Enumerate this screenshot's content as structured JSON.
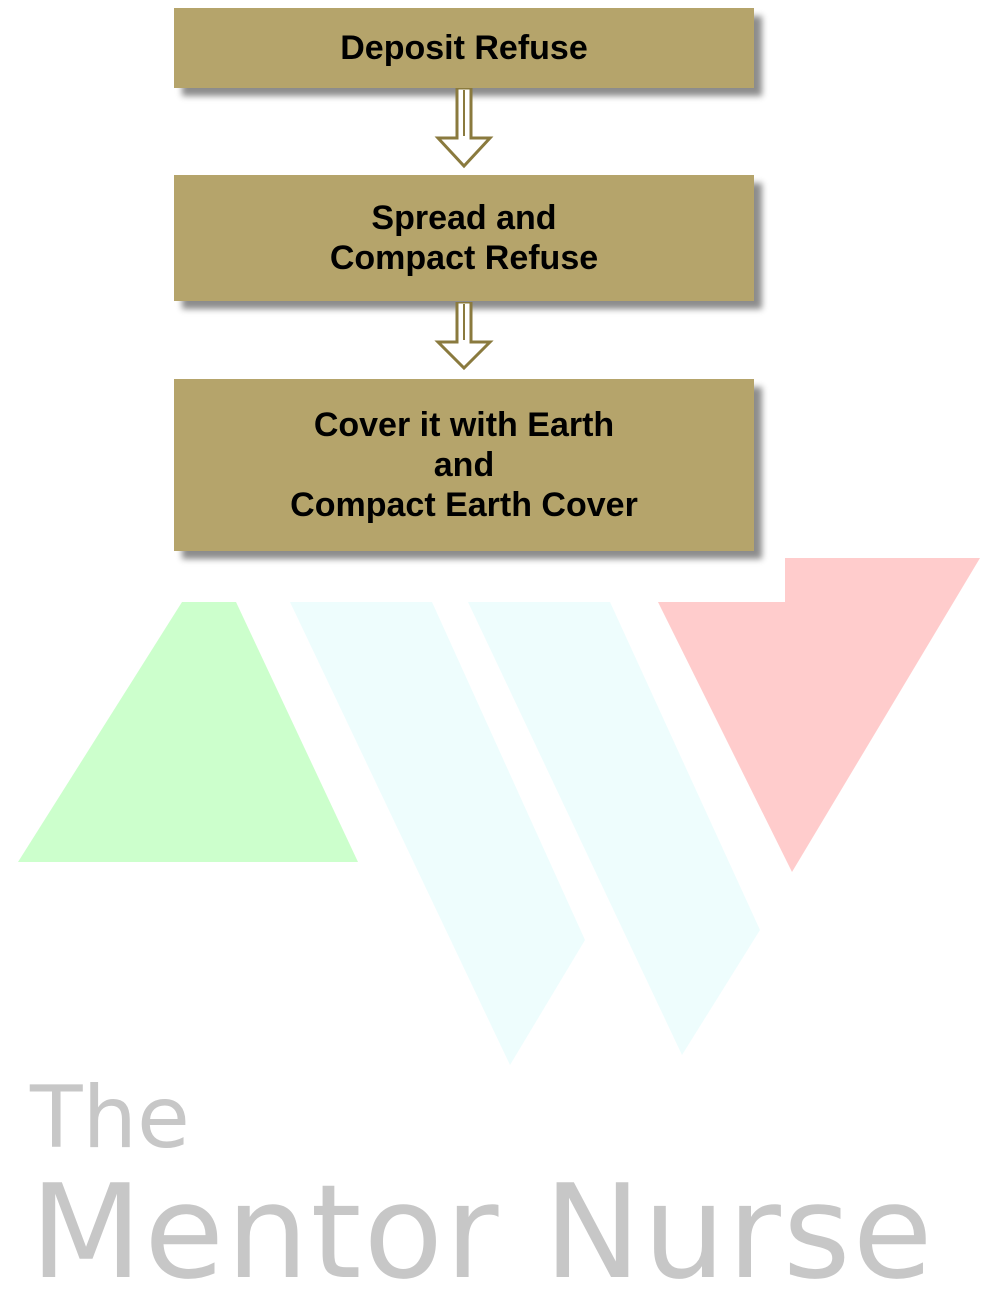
{
  "diagram": {
    "steps": [
      {
        "lines": [
          "Deposit Refuse"
        ]
      },
      {
        "lines": [
          "Spread and",
          "Compact Refuse"
        ]
      },
      {
        "lines": [
          "Cover it with Earth",
          "and",
          "Compact Earth Cover"
        ]
      }
    ],
    "box_color": "#b5a46b",
    "arrow_color": "#8a7a3e"
  },
  "watermark": {
    "brand_line1": "The",
    "brand_line2": "Mentor Nurse",
    "colors": {
      "green": "#ccffcc",
      "cyan": "#eefdfd",
      "red": "#ffcccc",
      "text": "#c7c7c7"
    }
  }
}
